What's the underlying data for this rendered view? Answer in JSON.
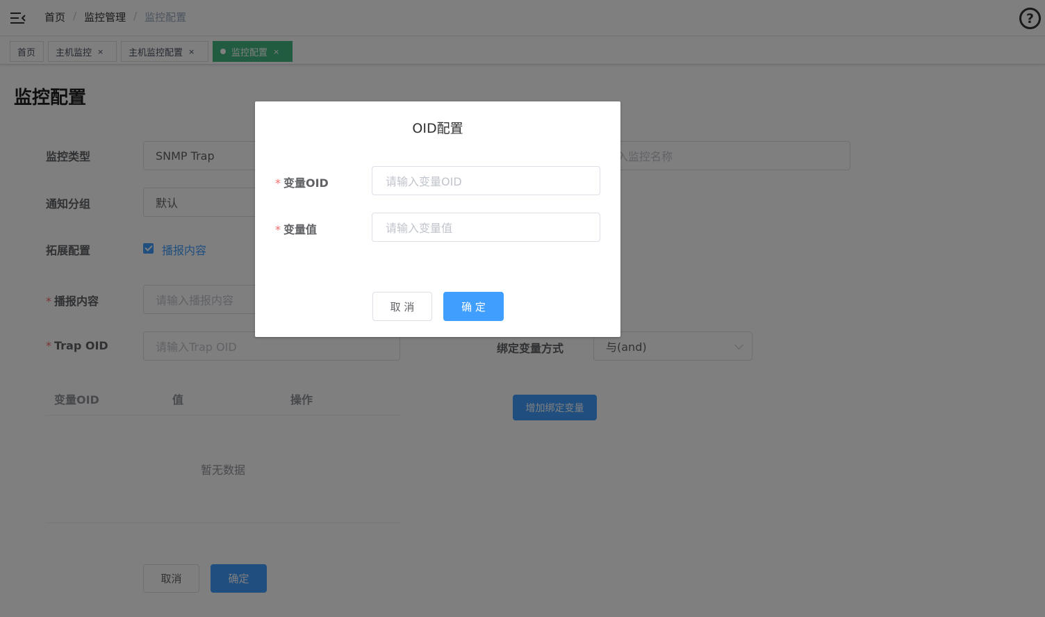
{
  "header": {
    "breadcrumb": [
      "首页",
      "监控管理",
      "监控配置"
    ],
    "separator": "/",
    "help_icon": "question-circle-icon"
  },
  "tags": [
    {
      "label": "首页",
      "closable": false,
      "active": false
    },
    {
      "label": "主机监控",
      "closable": true,
      "active": false
    },
    {
      "label": "主机监控配置",
      "closable": true,
      "active": false
    },
    {
      "label": "监控配置",
      "closable": true,
      "active": true
    }
  ],
  "tag_close_glyph": "×",
  "page": {
    "title": "监控配置",
    "form": {
      "monitor_type": {
        "label": "监控类型",
        "value": "SNMP Trap"
      },
      "monitor_name": {
        "placeholder": "输入监控名称"
      },
      "notify_group": {
        "label": "通知分组",
        "value": "默认"
      },
      "extend": {
        "label": "拓展配置",
        "checkbox_label": "播报内容",
        "checked": true
      },
      "broadcast": {
        "label": "播报内容",
        "placeholder": "请输入播报内容"
      },
      "trap_oid": {
        "label": "Trap OID",
        "placeholder": "请输入Trap OID"
      },
      "bind_mode": {
        "label": "绑定变量方式",
        "value": "与(and)"
      },
      "add_bind_button": "增加绑定变量"
    },
    "table": {
      "columns": [
        "变量OID",
        "值",
        "操作"
      ],
      "empty_text": "暂无数据"
    },
    "cancel_button": "取消",
    "confirm_button": "确定"
  },
  "dialog": {
    "title": "OID配置",
    "fields": [
      {
        "label": "变量OID",
        "placeholder": "请输入变量OID"
      },
      {
        "label": "变量值",
        "placeholder": "请输入变量值"
      }
    ],
    "cancel_button": "取 消",
    "confirm_button": "确 定"
  },
  "colors": {
    "primary": "#409eff",
    "tag_active": "#42b983",
    "required": "#f56c6c"
  }
}
